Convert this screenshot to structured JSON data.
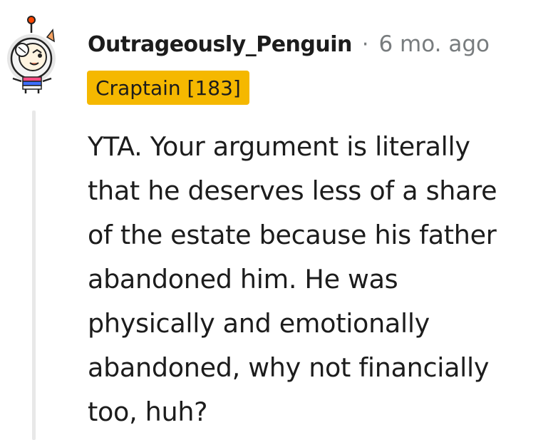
{
  "comment": {
    "username": "Outrageously_Penguin",
    "separator": "·",
    "timestamp": "6 mo. ago",
    "flair": "Craptain [183]",
    "body_lines": [
      "YTA. Your argument is literally",
      "that he deserves less of a share",
      "of the estate because his father",
      "abandoned him. He was",
      "physically and emotionally",
      "abandoned, why not financially",
      "too, huh?"
    ]
  },
  "colors": {
    "flair_background": "#f5b800",
    "username": "#1c1c1c",
    "meta": "#787c7e",
    "thread_line": "#e8e8e8"
  },
  "icons": {
    "avatar": "snoo-avatar-icon"
  }
}
